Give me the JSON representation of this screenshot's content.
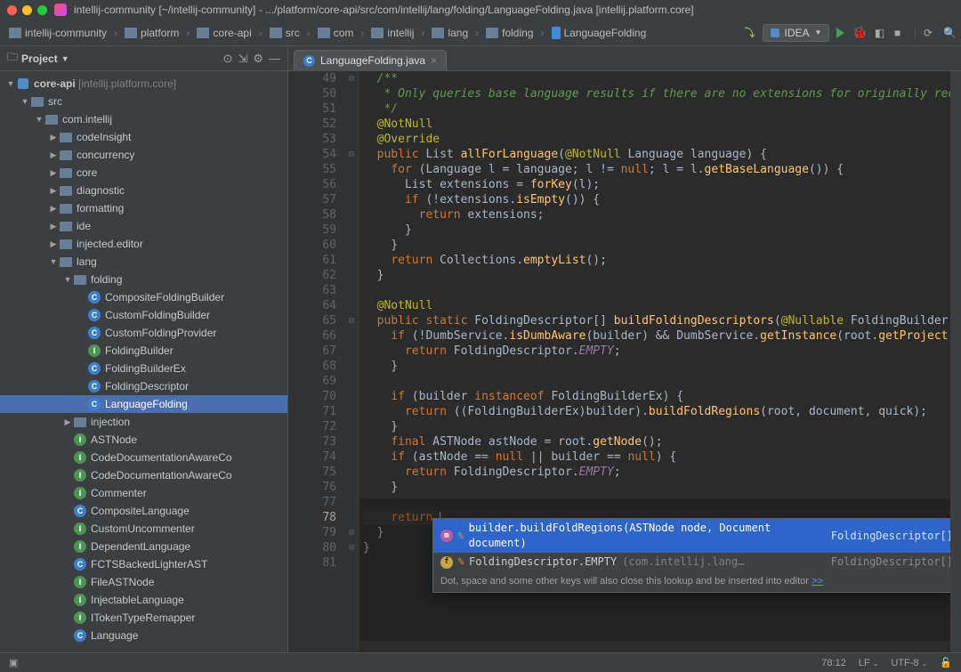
{
  "titlebar": {
    "text": "intellij-community [~/intellij-community] - .../platform/core-api/src/com/intellij/lang/folding/LanguageFolding.java [intellij.platform.core]"
  },
  "breadcrumbs": {
    "items": [
      "intellij-community",
      "platform",
      "core-api",
      "src",
      "com",
      "intellij",
      "lang",
      "folding",
      "LanguageFolding"
    ],
    "runconfig": "IDEA"
  },
  "project": {
    "label": "Project",
    "root_name": "core-api",
    "root_qualifier": "[intellij.platform.core]",
    "folders": {
      "src": "src",
      "pkg": "com.intellij",
      "codeInsight": "codeInsight",
      "concurrency": "concurrency",
      "core": "core",
      "diagnostic": "diagnostic",
      "formatting": "formatting",
      "ide": "ide",
      "injected": "injected.editor",
      "lang": "lang",
      "folding": "folding",
      "injection": "injection"
    },
    "folding_classes": [
      "CompositeFoldingBuilder",
      "CustomFoldingBuilder",
      "CustomFoldingProvider",
      "FoldingBuilder",
      "FoldingBuilderEx",
      "FoldingDescriptor",
      "LanguageFolding"
    ],
    "lang_classes": [
      "ASTNode",
      "CodeDocumentationAwareCo",
      "CodeDocumentationAwareCo",
      "Commenter",
      "CompositeLanguage",
      "CustomUncommenter",
      "DependentLanguage",
      "FCTSBackedLighterAST",
      "FileASTNode",
      "InjectableLanguage",
      "ITokenTypeRemapper",
      "Language"
    ]
  },
  "tab": {
    "name": "LanguageFolding.java"
  },
  "gutter": {
    "start": 49,
    "end": 81,
    "current": 78
  },
  "code": {
    "c49": "  /**",
    "c50": "   * Only queries base language results if there are no extensions for originally requested ",
    "c51": "   */",
    "c52a": "  @NotNull",
    "c53a": "  @Override",
    "c54": "  public List<FoldingBuilder> allForLanguage(@NotNull Language language) {",
    "c55": "    for (Language l = language; l != null; l = l.getBaseLanguage()) {",
    "c56": "      List<FoldingBuilder> extensions = forKey(l);",
    "c57": "      if (!extensions.isEmpty()) {",
    "c58": "        return extensions;",
    "c59": "      }",
    "c60": "    }",
    "c61": "    return Collections.emptyList();",
    "c62": "  }",
    "c64a": "  @NotNull",
    "c65": "  public static FoldingDescriptor[] buildFoldingDescriptors(@Nullable FoldingBuilder builder,",
    "c66": "    if (!DumbService.isDumbAware(builder) && DumbService.getInstance(root.getProject()).isDum",
    "c67": "      return FoldingDescriptor.EMPTY;",
    "c68": "    }",
    "c70": "    if (builder instanceof FoldingBuilderEx) {",
    "c71": "      return ((FoldingBuilderEx)builder).buildFoldRegions(root, document, quick);",
    "c72": "    }",
    "c73": "    final ASTNode astNode = root.getNode();",
    "c74": "    if (astNode == null || builder == null) {",
    "c75": "      return FoldingDescriptor.EMPTY;",
    "c76": "    }",
    "c78": "    return ",
    "c79": "  }",
    "c80": "}"
  },
  "popup": {
    "item1_sig": "builder.buildFoldRegions(ASTNode node, Document document)",
    "item1_type": "FoldingDescriptor[]",
    "item2_sig": "FoldingDescriptor.EMPTY",
    "item2_pkg": "(com.intellij.lang…",
    "item2_type": "FoldingDescriptor[]",
    "hint": "Dot, space and some other keys will also close this lookup and be inserted into editor",
    "hint_link": ">>"
  },
  "status": {
    "pos": "78:12",
    "lineend": "LF",
    "enc": "UTF-8"
  }
}
